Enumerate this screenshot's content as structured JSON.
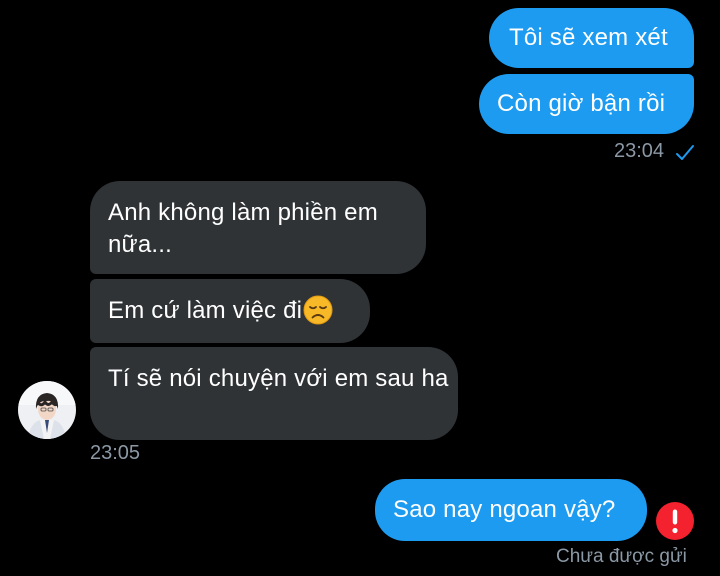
{
  "messages": [
    {
      "direction": "outgoing",
      "text": "Tôi sẽ xem xét"
    },
    {
      "direction": "outgoing",
      "text": "Còn giờ bận rồi"
    },
    {
      "direction": "incoming",
      "text": "Anh không làm phiền em nữa..."
    },
    {
      "direction": "incoming",
      "text": "Em cứ làm việc đi"
    },
    {
      "direction": "incoming",
      "text": "Tí sẽ nói chuyện với em sau ha"
    },
    {
      "direction": "outgoing",
      "text": "Sao nay ngoan vậy?"
    }
  ],
  "timestamps": {
    "outgoing_group": "23:04",
    "incoming_group": "23:05"
  },
  "status": {
    "sent_icon": "check-icon",
    "failed_icon": "error-exclamation-icon",
    "failed_label": "Chưa được gửi"
  },
  "emoji": {
    "disappointed": "disappointed-face-emoji"
  },
  "colors": {
    "background": "#000000",
    "outgoing_bubble": "#1d9bf0",
    "incoming_bubble": "#2f3336",
    "meta_text": "#8b98a5",
    "error": "#f4212e"
  }
}
